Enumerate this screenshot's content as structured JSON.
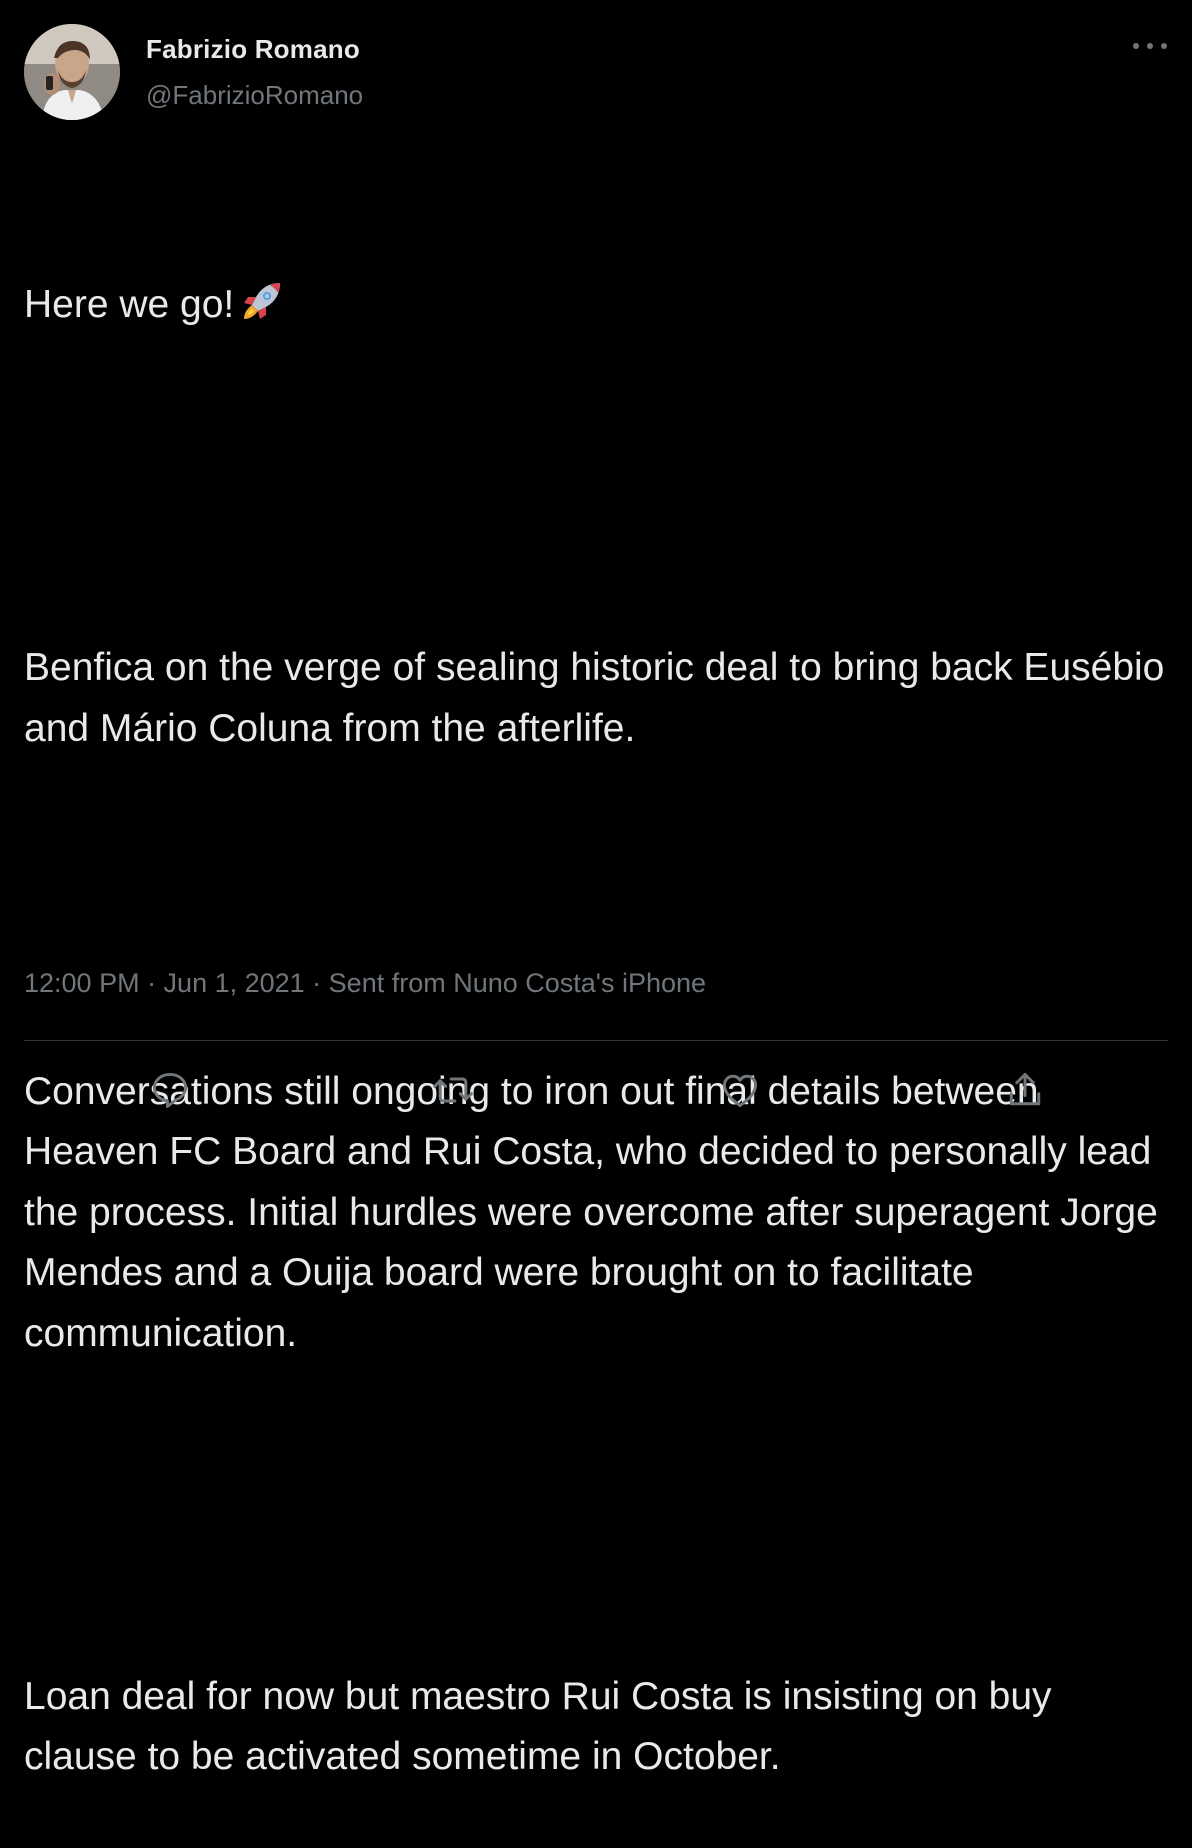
{
  "tweet": {
    "author_name": "Fabrizio Romano",
    "author_handle": "@FabrizioRomano",
    "paragraphs": [
      "Here we go!",
      "Benfica on the verge of sealing historic deal to bring back Eusébio and Mário Coluna from the afterlife.",
      "Conversations still ongoing to iron out final details between Heaven FC Board and Rui Costa, who decided to personally lead the process. Initial hurdles were overcome after superagent Jorge Mendes and a Ouija board were brought on to facilitate communication.",
      "Loan deal for now but maestro Rui Costa is insisting on buy clause to be activated sometime in October."
    ],
    "meta": "12:00 PM · Jun 1, 2021 · Sent from Nuno Costa's iPhone"
  },
  "icons": {
    "more": "more-horizontal-icon",
    "rocket": "rocket-emoji",
    "reply": "reply-icon",
    "retweet": "retweet-icon",
    "like": "like-icon",
    "share": "share-icon"
  },
  "colors": {
    "background": "#000000",
    "primary_text": "#e7e9ea",
    "secondary_text": "#71767b",
    "divider": "#2f3336"
  }
}
